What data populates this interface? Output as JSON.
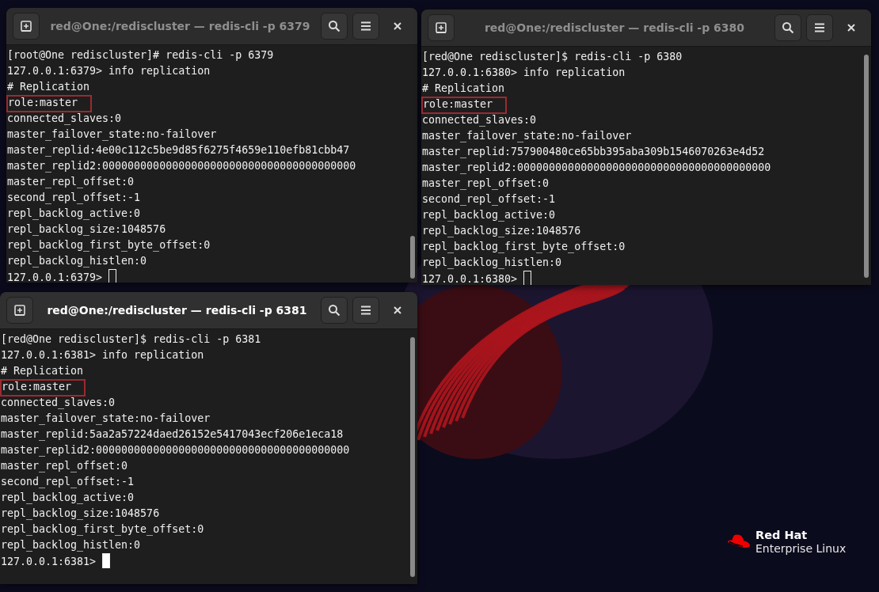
{
  "windows": [
    {
      "title": "red@One:/rediscluster — redis-cli -p 6379",
      "focused": false,
      "lines": [
        {
          "text": "[root@One rediscluster]# redis-cli -p 6379",
          "highlighted": false
        },
        {
          "text": "127.0.0.1:6379> info replication",
          "highlighted": false
        },
        {
          "text": "# Replication",
          "highlighted": false
        },
        {
          "text": "role:master",
          "highlighted": true
        },
        {
          "text": "connected_slaves:0",
          "highlighted": false
        },
        {
          "text": "master_failover_state:no-failover",
          "highlighted": false
        },
        {
          "text": "master_replid:4e00c112c5be9d85f6275f4659e110efb81cbb47",
          "highlighted": false
        },
        {
          "text": "master_replid2:0000000000000000000000000000000000000000",
          "highlighted": false
        },
        {
          "text": "master_repl_offset:0",
          "highlighted": false
        },
        {
          "text": "second_repl_offset:-1",
          "highlighted": false
        },
        {
          "text": "repl_backlog_active:0",
          "highlighted": false
        },
        {
          "text": "repl_backlog_size:1048576",
          "highlighted": false
        },
        {
          "text": "repl_backlog_first_byte_offset:0",
          "highlighted": false
        },
        {
          "text": "repl_backlog_histlen:0",
          "highlighted": false
        }
      ],
      "prompt": "127.0.0.1:6379>"
    },
    {
      "title": "red@One:/rediscluster — redis-cli -p 6380",
      "focused": false,
      "lines": [
        {
          "text": "[red@One rediscluster]$ redis-cli -p 6380",
          "highlighted": false
        },
        {
          "text": "127.0.0.1:6380> info replication",
          "highlighted": false
        },
        {
          "text": "# Replication",
          "highlighted": false
        },
        {
          "text": "role:master",
          "highlighted": true
        },
        {
          "text": "connected_slaves:0",
          "highlighted": false
        },
        {
          "text": "master_failover_state:no-failover",
          "highlighted": false
        },
        {
          "text": "master_replid:757900480ce65bb395aba309b1546070263e4d52",
          "highlighted": false
        },
        {
          "text": "master_replid2:0000000000000000000000000000000000000000",
          "highlighted": false
        },
        {
          "text": "master_repl_offset:0",
          "highlighted": false
        },
        {
          "text": "second_repl_offset:-1",
          "highlighted": false
        },
        {
          "text": "repl_backlog_active:0",
          "highlighted": false
        },
        {
          "text": "repl_backlog_size:1048576",
          "highlighted": false
        },
        {
          "text": "repl_backlog_first_byte_offset:0",
          "highlighted": false
        },
        {
          "text": "repl_backlog_histlen:0",
          "highlighted": false
        }
      ],
      "prompt": "127.0.0.1:6380>"
    },
    {
      "title": "red@One:/rediscluster — redis-cli -p 6381",
      "focused": true,
      "lines": [
        {
          "text": "[red@One rediscluster]$ redis-cli -p 6381",
          "highlighted": false
        },
        {
          "text": "127.0.0.1:6381> info replication",
          "highlighted": false
        },
        {
          "text": "# Replication",
          "highlighted": false
        },
        {
          "text": "role:master",
          "highlighted": true
        },
        {
          "text": "connected_slaves:0",
          "highlighted": false
        },
        {
          "text": "master_failover_state:no-failover",
          "highlighted": false
        },
        {
          "text": "master_replid:5aa2a57224daed26152e5417043ecf206e1eca18",
          "highlighted": false
        },
        {
          "text": "master_replid2:0000000000000000000000000000000000000000",
          "highlighted": false
        },
        {
          "text": "master_repl_offset:0",
          "highlighted": false
        },
        {
          "text": "second_repl_offset:-1",
          "highlighted": false
        },
        {
          "text": "repl_backlog_active:0",
          "highlighted": false
        },
        {
          "text": "repl_backlog_size:1048576",
          "highlighted": false
        },
        {
          "text": "repl_backlog_first_byte_offset:0",
          "highlighted": false
        },
        {
          "text": "repl_backlog_histlen:0",
          "highlighted": false
        }
      ],
      "prompt": "127.0.0.1:6381>"
    }
  ],
  "logo": {
    "brand": "Red Hat",
    "product": "Enterprise Linux"
  }
}
